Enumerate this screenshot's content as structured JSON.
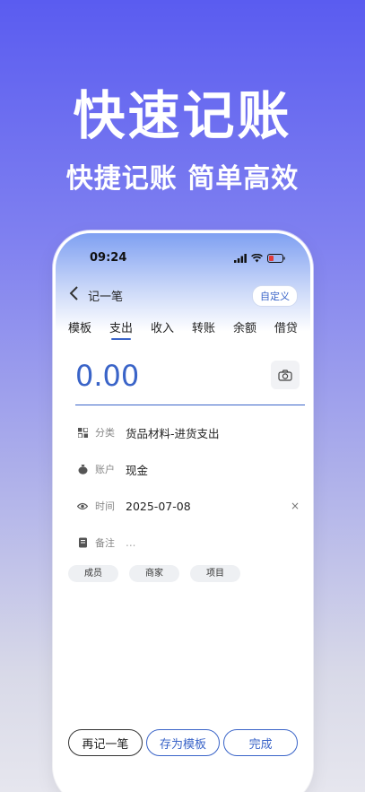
{
  "banner": {
    "headline": "快速记账",
    "subline": "快捷记账  简单高效"
  },
  "status_bar": {
    "time": "09:24"
  },
  "nav": {
    "title": "记一笔",
    "custom_label": "自定义"
  },
  "tabs": [
    {
      "label": "模板",
      "active": false
    },
    {
      "label": "支出",
      "active": true
    },
    {
      "label": "收入",
      "active": false
    },
    {
      "label": "转账",
      "active": false
    },
    {
      "label": "余额",
      "active": false
    },
    {
      "label": "借贷",
      "active": false
    }
  ],
  "amount": "0.00",
  "fields": {
    "category": {
      "label": "分类",
      "value": "货品材料-进货支出"
    },
    "account": {
      "label": "账户",
      "value": "现金"
    },
    "time": {
      "label": "时间",
      "value": "2025-07-08",
      "clear": "×"
    },
    "note": {
      "label": "备注",
      "placeholder": "..."
    }
  },
  "chips": [
    "成员",
    "商家",
    "项目"
  ],
  "buttons": {
    "again": "再记一笔",
    "save_template": "存为模板",
    "done": "完成"
  },
  "colors": {
    "accent": "#3a64c8",
    "banner_top": "#5a5cf0"
  }
}
